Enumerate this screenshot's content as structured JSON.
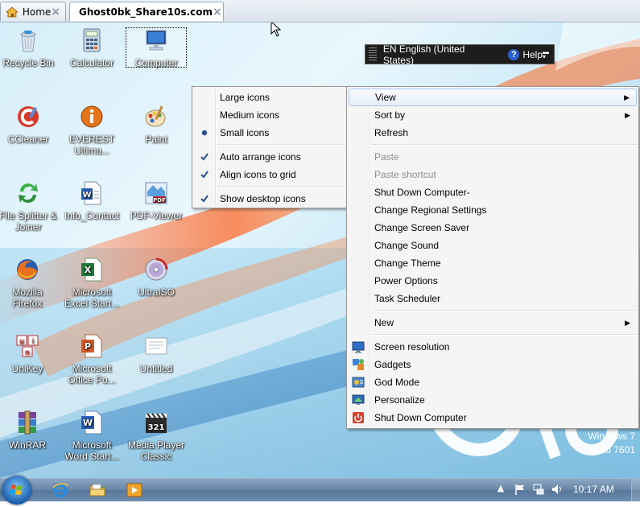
{
  "tabs": [
    {
      "label": "Home",
      "active": false
    },
    {
      "label": "Ghost0bk_Share10s.com",
      "active": true
    }
  ],
  "language_bar": {
    "language": "EN English (United States)",
    "help": "Help"
  },
  "desktop_icons": [
    {
      "label": "Recycle Bin",
      "icon": "recycle-bin-icon"
    },
    {
      "label": "Calculator",
      "icon": "calculator-icon"
    },
    {
      "label": "Computer",
      "icon": "computer-icon"
    },
    {
      "label": "CCleaner",
      "icon": "ccleaner-icon"
    },
    {
      "label": "EVEREST Ultima...",
      "icon": "everest-icon"
    },
    {
      "label": "Paint",
      "icon": "paint-icon"
    },
    {
      "label": "File Splitter & Joiner",
      "icon": "file-splitter-icon"
    },
    {
      "label": "Info_Contact",
      "icon": "word-doc-icon"
    },
    {
      "label": "PDF-Viewer",
      "icon": "pdf-icon"
    },
    {
      "label": "Mozilla Firefox",
      "icon": "firefox-icon"
    },
    {
      "label": "Microsoft Excel Start...",
      "icon": "excel-icon"
    },
    {
      "label": "UltraISO",
      "icon": "ultraiso-icon"
    },
    {
      "label": "UniKey",
      "icon": "unikey-icon"
    },
    {
      "label": "Microsoft Office Po...",
      "icon": "powerpoint-icon"
    },
    {
      "label": "Untitled",
      "icon": "document-icon"
    },
    {
      "label": "WinRAR",
      "icon": "winrar-icon"
    },
    {
      "label": "Microsoft Word Start...",
      "icon": "word-icon"
    },
    {
      "label": "Media Player Classic",
      "icon": "media-player-icon"
    }
  ],
  "view_submenu": [
    {
      "label": "Large icons",
      "mark": ""
    },
    {
      "label": "Medium icons",
      "mark": ""
    },
    {
      "label": "Small icons",
      "mark": "bullet"
    },
    {
      "label": "Auto arrange icons",
      "mark": "check"
    },
    {
      "label": "Align icons to grid",
      "mark": "check"
    },
    {
      "label": "Show desktop icons",
      "mark": "check"
    }
  ],
  "context_menu": [
    {
      "label": "View",
      "submenu": true,
      "hover": true
    },
    {
      "label": "Sort by",
      "submenu": true
    },
    {
      "label": "Refresh"
    },
    {
      "label": "Paste",
      "disabled": true
    },
    {
      "label": "Paste shortcut",
      "disabled": true
    },
    {
      "label": "Shut Down Computer-"
    },
    {
      "label": "Change Regional Settings"
    },
    {
      "label": "Change Screen Saver"
    },
    {
      "label": "Change Sound"
    },
    {
      "label": "Change Theme"
    },
    {
      "label": "Power Options"
    },
    {
      "label": "Task Scheduler"
    },
    {
      "label": "New",
      "submenu": true
    },
    {
      "label": "Screen resolution",
      "icon": "screen-resolution-icon"
    },
    {
      "label": "Gadgets",
      "icon": "gadgets-icon"
    },
    {
      "label": "God Mode",
      "icon": "god-mode-icon"
    },
    {
      "label": "Personalize",
      "icon": "personalize-icon"
    },
    {
      "label": "Shut Down Computer",
      "icon": "shutdown-icon"
    }
  ],
  "watermark": {
    "line1": "Windows 7",
    "line2": "Build 7601"
  },
  "taskbar": {
    "pinned": [
      "internet-explorer-icon",
      "explorer-folder-icon",
      "media-player-icon"
    ],
    "clock": "10:17 AM"
  }
}
